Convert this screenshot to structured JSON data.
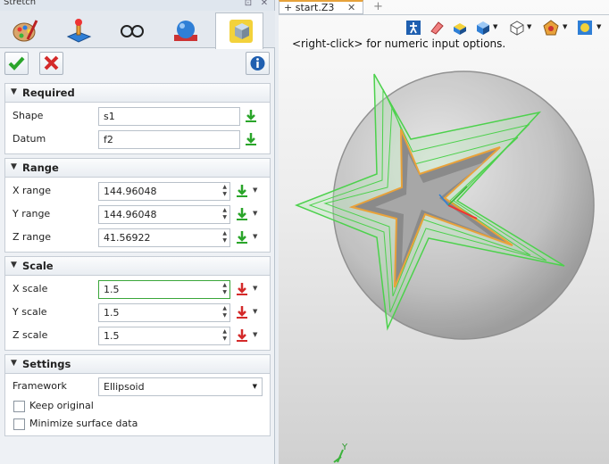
{
  "panel": {
    "title": "Stretch",
    "tabs": [
      {
        "icon": "paint-palette-icon"
      },
      {
        "icon": "joystick-icon"
      },
      {
        "icon": "glasses-icon"
      },
      {
        "icon": "sphere-icon"
      },
      {
        "icon": "cube-icon",
        "active": true
      }
    ],
    "actions": {
      "ok": "ok-check-icon",
      "cancel": "cancel-x-icon",
      "info": "info-icon"
    },
    "sections": {
      "required": {
        "title": "Required",
        "shape_label": "Shape",
        "shape_value": "s1",
        "datum_label": "Datum",
        "datum_value": "f2"
      },
      "range": {
        "title": "Range",
        "x_label": "X range",
        "x_value": "144.96048",
        "y_label": "Y range",
        "y_value": "144.96048",
        "z_label": "Z range",
        "z_value": "41.56922"
      },
      "scale": {
        "title": "Scale",
        "x_label": "X scale",
        "x_value": "1.5",
        "y_label": "Y scale",
        "y_value": "1.5",
        "z_label": "Z scale",
        "z_value": "1.5"
      },
      "settings": {
        "title": "Settings",
        "framework_label": "Framework",
        "framework_value": "Ellipsoid",
        "keep_original_label": "Keep original",
        "keep_original_checked": false,
        "minimize_label": "Minimize surface data",
        "minimize_checked": false
      }
    }
  },
  "viewport": {
    "doc_tab": "start.Z3",
    "hint": "<right-click> for numeric input options.",
    "axis_y_label": "Y",
    "colors": {
      "accent_tab": "#e7a23b",
      "wire_green": "#4cd14c",
      "star_edge": "#e9a23a"
    }
  }
}
